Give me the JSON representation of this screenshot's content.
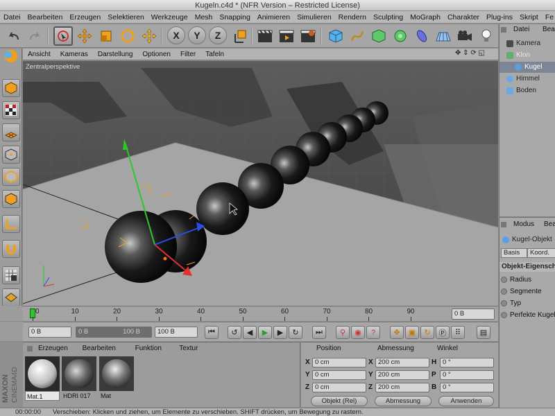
{
  "window": {
    "title": "Kugeln.c4d * (NFR Version – Restricted License)"
  },
  "menubar": [
    "Datei",
    "Bearbeiten",
    "Erzeugen",
    "Selektieren",
    "Werkzeuge",
    "Mesh",
    "Snapping",
    "Animieren",
    "Simulieren",
    "Rendern",
    "Sculpting",
    "MoGraph",
    "Charakter",
    "Plug-ins",
    "Skript",
    "Fe"
  ],
  "toolbar": {
    "axis_x": "X",
    "axis_y": "Y",
    "axis_z": "Z"
  },
  "viewport": {
    "menu": [
      "Ansicht",
      "Kameras",
      "Darstellung",
      "Optionen",
      "Filter",
      "Tafeln"
    ],
    "label": "Zentralperspektive"
  },
  "timeline": {
    "ticks": [
      "0",
      "10",
      "20",
      "30",
      "40",
      "50",
      "60",
      "70",
      "80",
      "90"
    ],
    "frame_end": "0 B"
  },
  "transport": {
    "start": "0 B",
    "current": "0 B",
    "range_end": "100 B",
    "end": "100 B"
  },
  "material_manager": {
    "menu": [
      "Erzeugen",
      "Bearbeiten",
      "Funktion",
      "Textur"
    ],
    "materials": [
      {
        "name": "Mat.1",
        "selected": true
      },
      {
        "name": "HDRI 017",
        "selected": false
      },
      {
        "name": "Mat",
        "selected": false
      }
    ],
    "brand_line1": "MAXON",
    "brand_line2": "CINEMA4D"
  },
  "coordinates": {
    "headers": [
      "Position",
      "Abmessung",
      "Winkel"
    ],
    "axes_pos": [
      "X",
      "Y",
      "Z"
    ],
    "axes_size": [
      "X",
      "Y",
      "Z"
    ],
    "axes_rot": [
      "H",
      "P",
      "B"
    ],
    "position": [
      "0 cm",
      "0 cm",
      "0 cm"
    ],
    "size": [
      "200 cm",
      "200 cm",
      "200 cm"
    ],
    "rotation": [
      "0 °",
      "0 °",
      "0 °"
    ],
    "mode_dropdown": "Objekt (Rel)",
    "size_dropdown": "Abmessung",
    "apply_button": "Anwenden"
  },
  "object_manager": {
    "menu": [
      "Datei",
      "Bearb"
    ],
    "objects": [
      {
        "name": "Kamera",
        "level": 0,
        "selected": false,
        "color": "#4a4a4a"
      },
      {
        "name": "Klon",
        "level": 0,
        "selected": false,
        "color": "#5fae6a",
        "dim": true
      },
      {
        "name": "Kugel",
        "level": 1,
        "selected": true,
        "color": "#5aa0e0"
      },
      {
        "name": "Himmel",
        "level": 0,
        "selected": false,
        "color": "#6aa8e8"
      },
      {
        "name": "Boden",
        "level": 0,
        "selected": false,
        "color": "#6aa8e8"
      }
    ]
  },
  "attribute_manager": {
    "menu": [
      "Modus",
      "Bearb"
    ],
    "object_title": "Kugel-Objekt",
    "tabs": [
      "Basis",
      "Koord."
    ],
    "section": "Objekt-Eigenschaften",
    "fields": [
      "Radius",
      "Segmente",
      "Typ",
      "Perfekte Kugel"
    ]
  },
  "status": {
    "time": "00:00:00",
    "message": "Verschieben: Klicken und ziehen, um Elemente zu verschieben. SHIFT drücken, um Bewegung zu rastern."
  },
  "colors": {
    "accent_play": "#2aa02a",
    "record": "#c83030",
    "axis_x": "#e23030",
    "axis_y": "#2ac82a",
    "axis_z": "#2a4ee2",
    "selection": "#7d8694"
  }
}
